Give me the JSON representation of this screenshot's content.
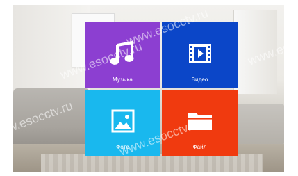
{
  "tiles": {
    "music": {
      "label": "Музыка",
      "color": "#8c3fd1",
      "icon": "music-note-icon"
    },
    "video": {
      "label": "Видео",
      "color": "#0b46c8",
      "icon": "film-icon"
    },
    "photo": {
      "label": "Фото",
      "color": "#19b8ee",
      "icon": "image-icon"
    },
    "file": {
      "label": "Файл",
      "color": "#f03a0f",
      "icon": "folder-icon"
    }
  },
  "watermarks": [
    "www.esocctv.ru",
    "www.esocctv.ru",
    "www.esocctv.ru",
    "www.esocctv.ru",
    "www.esocctv.ru"
  ]
}
